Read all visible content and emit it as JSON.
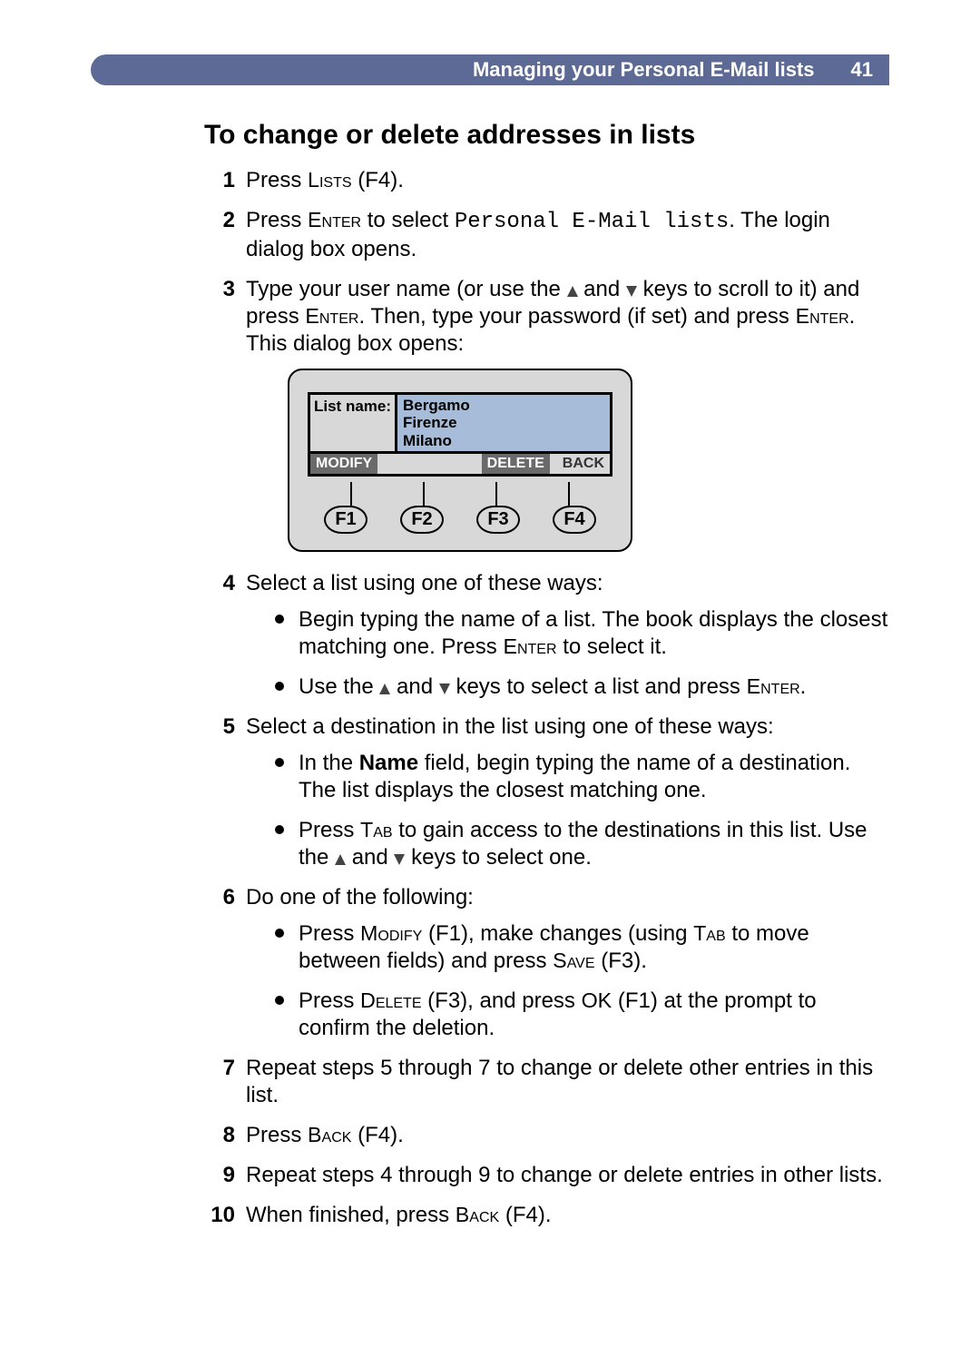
{
  "header": {
    "title": "Managing your Personal E-Mail lists",
    "page_number": "41"
  },
  "section_title": "To change or delete addresses in lists",
  "keys": {
    "lists": "Lists",
    "enter": "Enter",
    "tab": "Tab",
    "modify": "Modify",
    "save": "Save",
    "delete": "Delete",
    "ok": "OK",
    "back": "Back",
    "f1": "F1",
    "f2": "F2",
    "f3": "F3",
    "f4": "F4"
  },
  "mono_personal": "Personal E-Mail lists",
  "steps": {
    "s1_a": "Press ",
    "s1_b": " (F4).",
    "s2_a": "Press ",
    "s2_b": " to select ",
    "s2_c": ". The login dialog box opens.",
    "s3_a": "Type your user name (or use the ",
    "s3_b": " and ",
    "s3_c": " keys to scroll to it) and press ",
    "s3_d": ". Then, type your password (if set) and press ",
    "s3_e": ". This dialog box opens:",
    "s4": "Select a list using one of these ways:",
    "s4_b1_a": "Begin typing the name of a list. The book displays the closest matching one. Press ",
    "s4_b1_b": " to select it.",
    "s4_b2_a": "Use the ",
    "s4_b2_b": " and ",
    "s4_b2_c": " keys to select a list and press ",
    "s4_b2_d": ".",
    "s5": "Select a destination in the list using one of these ways:",
    "s5_b1_a": "In the ",
    "s5_b1_name": "Name",
    "s5_b1_b": " field, begin typing the name of a destination. The list displays the closest matching one.",
    "s5_b2_a": "Press ",
    "s5_b2_b": " to gain access to the destinations in this list. Use the ",
    "s5_b2_c": " and ",
    "s5_b2_d": " keys to select one.",
    "s6": "Do one of the following:",
    "s6_b1_a": "Press ",
    "s6_b1_b": " (F1), make changes (using ",
    "s6_b1_c": " to move between fields) and press ",
    "s6_b1_d": " (F3).",
    "s6_b2_a": "Press ",
    "s6_b2_b": " (F3), and press ",
    "s6_b2_c": " (F1) at the prompt to confirm the deletion.",
    "s7": "Repeat steps 5 through 7 to change or delete other entries in this list.",
    "s8_a": "Press ",
    "s8_b": " (F4).",
    "s9": "Repeat steps 4 through 9 to change or delete entries in other lists.",
    "s10_a": "When finished, press ",
    "s10_b": " (F4)."
  },
  "dialog": {
    "list_name_label": "List name:",
    "items": [
      "Bergamo",
      "Firenze",
      "Milano"
    ],
    "modify": "MODIFY",
    "delete": "DELETE",
    "back": "BACK",
    "f1": "F1",
    "f2": "F2",
    "f3": "F3",
    "f4": "F4"
  }
}
